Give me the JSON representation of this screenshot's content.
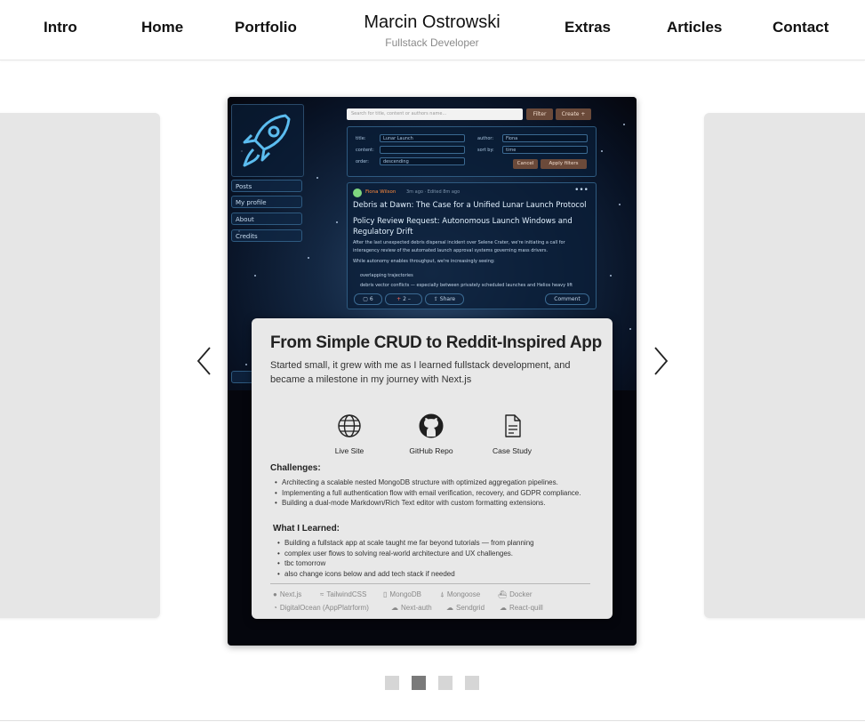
{
  "nav": {
    "intro": "Intro",
    "home": "Home",
    "portfolio": "Portfolio",
    "extras": "Extras",
    "articles": "Articles",
    "contact": "Contact",
    "brand_name": "Marcin Ostrowski",
    "brand_sub": "Fullstack Developer"
  },
  "screenshot": {
    "sidebar": [
      "Posts",
      "My profile",
      "About",
      "Credits"
    ],
    "search_placeholder": "Search for title, content or authors name...",
    "filter_btn": "Filter",
    "create_btn": "Create +",
    "filters": {
      "title_label": "title:",
      "title_value": "Lunar Launch",
      "content_label": "content:",
      "order_label": "order:",
      "order_value": "descending",
      "author_label": "author:",
      "author_value": "Fiona",
      "sortby_label": "sort by:",
      "sortby_value": "time",
      "cancel_btn": "Cancel",
      "apply_btn": "Apply filters"
    },
    "post": {
      "author": "Fiona Wilson",
      "meta": "3m ago · Edited 8m ago",
      "title1": "Debris at Dawn: The Case for a Unified Lunar Launch Protocol",
      "title2": "Policy Review Request: Autonomous Launch Windows and Regulatory Drift",
      "para1": "After the last unexpected debris dispersal incident over Selene Crater, we're initiating a call for interagency review of the automated launch approval systems governing mass drivers.",
      "para2": "While autonomy enables throughput, we're increasingly seeing:",
      "li1": "overlapping trajectories",
      "li2": "debris vector conflicts — especially between privately scheduled launches and Helios heavy lift",
      "comments": "6",
      "votes": "2",
      "share": "Share",
      "comment_btn": "Comment"
    }
  },
  "project": {
    "title": "From Simple CRUD to Reddit-Inspired App",
    "description": "Started small, it grew with me as I learned fullstack development, and became a milestone in my journey with Next.js",
    "links": {
      "live": "Live Site",
      "repo": "GitHub Repo",
      "case": "Case Study"
    },
    "challenges_heading": "Challenges:",
    "challenges": [
      "Architecting a scalable nested MongoDB structure with optimized aggregation pipelines.",
      "Implementing a full authentication flow with email verification, recovery, and GDPR compliance.",
      "Building a dual-mode Markdown/Rich Text editor with custom formatting extensions."
    ],
    "learned_heading": "What I Learned:",
    "learned": [
      "Building a fullstack app at scale taught me far beyond tutorials — from planning",
      "complex user flows to solving real-world architecture and UX challenges.",
      "tbc tomorrow",
      "also change icons below and add tech stack if needed"
    ],
    "tech_row1": [
      "Next.js",
      "TailwindCSS",
      "MongoDB",
      "Mongoose",
      "Docker"
    ],
    "tech_row2": [
      "DigitalOcean (AppPlatrform)",
      "Next-auth",
      "Sendgrid",
      "React-quill"
    ]
  },
  "carousel": {
    "active_index": 1,
    "count": 4
  }
}
